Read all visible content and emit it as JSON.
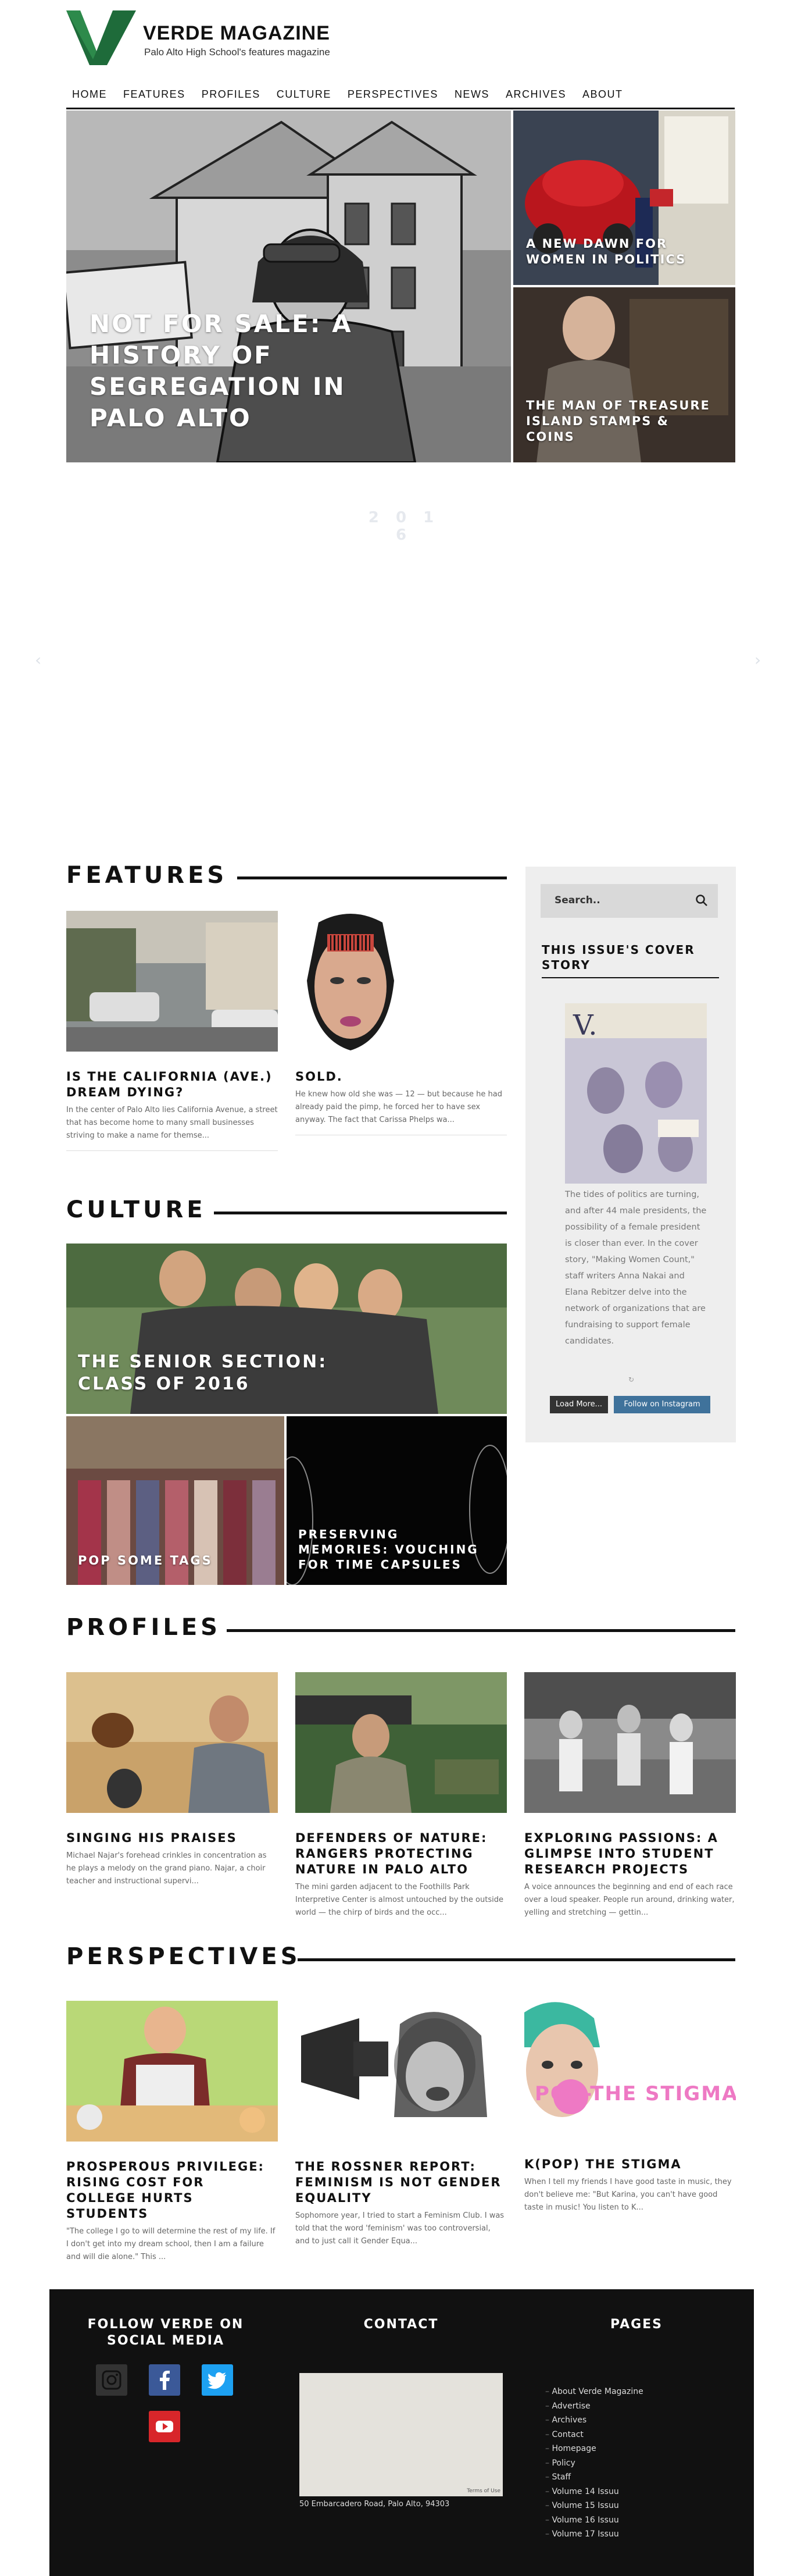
{
  "header": {
    "brand_name": "VERDE MAGAZINE",
    "tagline": "Palo Alto High School's features magazine",
    "nav": [
      "HOME",
      "FEATURES",
      "PROFILES",
      "CULTURE",
      "PERSPECTIVES",
      "NEWS",
      "ARCHIVES",
      "ABOUT"
    ]
  },
  "hero": {
    "main_title": "NOT FOR SALE: A HISTORY OF SEGREGATION IN PALO ALTO",
    "side1_title": "A NEW DAWN FOR WOMEN IN POLITICS",
    "side2_title": "THE MAN OF TREASURE ISLAND STAMPS & COINS"
  },
  "issuu_faint": "2 0 1 6",
  "features": {
    "heading": "FEATURES",
    "cards": [
      {
        "title": "IS THE CALIFORNIA (AVE.) DREAM DYING?",
        "excerpt": "In the center of Palo Alto lies California Avenue, a street that has become home to many small businesses striving to make a name for themse..."
      },
      {
        "title": "SOLD.",
        "excerpt": "He knew how old she was — 12 — but because he had already paid the pimp, he forced her to have sex anyway. The fact that Carissa Phelps wa..."
      }
    ]
  },
  "sidebar": {
    "search_placeholder": "Search..",
    "cover_heading": "THIS ISSUE'S COVER STORY",
    "cover_text": "The tides of politics are turning, and after 44 male presidents, the possibility of a female president is closer than ever. In the cover story, \"Making Women Count,\" staff writers Anna Nakai and Elana Rebitzer delve into the network of organizations that are fundraising to support female candidates.",
    "load_more": "Load More...",
    "follow_instagram": "Follow on Instagram"
  },
  "culture": {
    "heading": "CULTURE",
    "main_title": "THE SENIOR SECTION: CLASS OF 2016",
    "s1_title": "POP SOME TAGS",
    "s2_title": "PRESERVING MEMORIES: VOUCHING FOR TIME CAPSULES"
  },
  "profiles": {
    "heading": "PROFILES",
    "cards": [
      {
        "title": "SINGING HIS PRAISES",
        "excerpt": "Michael Najar's forehead crinkles in concentration as he plays a melody on the grand piano. Najar, a choir teacher and instructional supervi..."
      },
      {
        "title": "DEFENDERS OF NATURE: RANGERS PROTECTING NATURE IN PALO ALTO",
        "excerpt": "The mini garden adjacent to the Foothills Park Interpretive Center is almost untouched by the outside world — the chirp of birds and the occ..."
      },
      {
        "title": "EXPLORING PASSIONS: A GLIMPSE INTO STUDENT RESEARCH PROJECTS",
        "excerpt": "A voice announces the beginning and end of each race over a loud speaker. People run around, drinking water, yelling and stretching — gettin..."
      }
    ]
  },
  "perspectives": {
    "heading": "PERSPECTIVES",
    "kpop_graphic_text": "POP-THE STIGMA",
    "cards": [
      {
        "title": "PROSPEROUS PRIVILEGE: RISING COST FOR COLLEGE HURTS STUDENTS",
        "excerpt": "\"The college I go to will determine the rest of my life. If I don't get into my dream school, then I am a failure and will die alone.\" This ..."
      },
      {
        "title": "THE ROSSNER REPORT: FEMINISM IS NOT GENDER EQUALITY",
        "excerpt": "Sophomore year, I tried to start a Feminism Club. I was told that the word 'feminism' was too controversial, and to just call it Gender Equa..."
      },
      {
        "title": "K(POP) THE STIGMA",
        "excerpt": "When I tell my friends I have good taste in music, they don't believe me: \"But Karina, you can't have good taste in music! You listen to K..."
      }
    ]
  },
  "footer": {
    "follow_heading": "FOLLOW VERDE ON SOCIAL MEDIA",
    "contact_heading": "CONTACT",
    "pages_heading": "PAGES",
    "address": "50 Embarcadero Road, Palo Alto, 94303",
    "map_terms": "Terms of Use",
    "pages": [
      "About Verde Magazine",
      "Advertise",
      "Archives",
      "Contact",
      "Homepage",
      "Policy",
      "Staff",
      "Volume 14 Issuu",
      "Volume 15 Issuu",
      "Volume 16 Issuu",
      "Volume 17 Issuu"
    ]
  },
  "colors": {
    "brand_green": "#1f6b3a",
    "footer_bg": "#111111",
    "instagram_blue": "#3f729b",
    "facebook_blue": "#3b5998",
    "twitter_blue": "#1da1f2",
    "youtube_red": "#d8262a"
  }
}
